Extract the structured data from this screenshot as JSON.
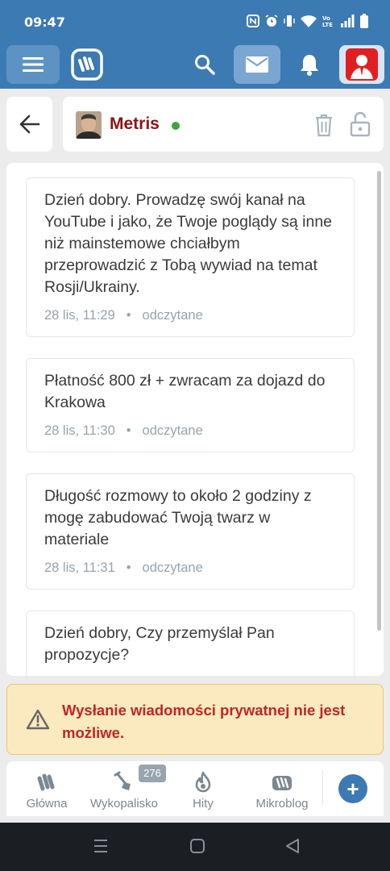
{
  "status_bar": {
    "time": "09:47",
    "icons": [
      "nfc-icon",
      "alarm-icon",
      "vibrate-icon",
      "wifi-icon",
      "volte-icon",
      "signal-icon",
      "battery-icon"
    ]
  },
  "conversation": {
    "username": "Metris",
    "online": true
  },
  "messages": [
    {
      "text": "Dzień dobry. Prowadzę swój kanał na YouTube i jako, że Twoje poglądy są inne niż mainstemowe chciałbym przeprowadzić z Tobą wywiad na temat Rosji/Ukrainy.",
      "time": "28 lis, 11:29",
      "status": "odczytane"
    },
    {
      "text": "Płatność 800 zł + zwracam za dojazd do Krakowa",
      "time": "28 lis, 11:30",
      "status": "odczytane"
    },
    {
      "text": "Długość rozmowy to około 2 godziny z mogę zabudować Twoją twarz w materiale",
      "time": "28 lis, 11:31",
      "status": "odczytane"
    },
    {
      "text": "Dzień dobry, Czy przemyślał Pan propozycje?",
      "time": "",
      "status": ""
    }
  ],
  "warning": {
    "text": "Wysłanie wiadomości prywatnej nie jest możliwe."
  },
  "bottom_nav": {
    "items": [
      {
        "label": "Główna",
        "icon": "home-logo-icon"
      },
      {
        "label": "Wykopalisko",
        "icon": "shovel-icon",
        "badge": "276"
      },
      {
        "label": "Hity",
        "icon": "flame-icon"
      },
      {
        "label": "Mikroblog",
        "icon": "mikroblog-icon"
      }
    ],
    "add_label": "+"
  },
  "colors": {
    "brand": "#3c7ab3",
    "username": "#8b1414",
    "online": "#3aa53a",
    "warning_bg": "#fbeac0",
    "warning_text": "#c02525"
  }
}
